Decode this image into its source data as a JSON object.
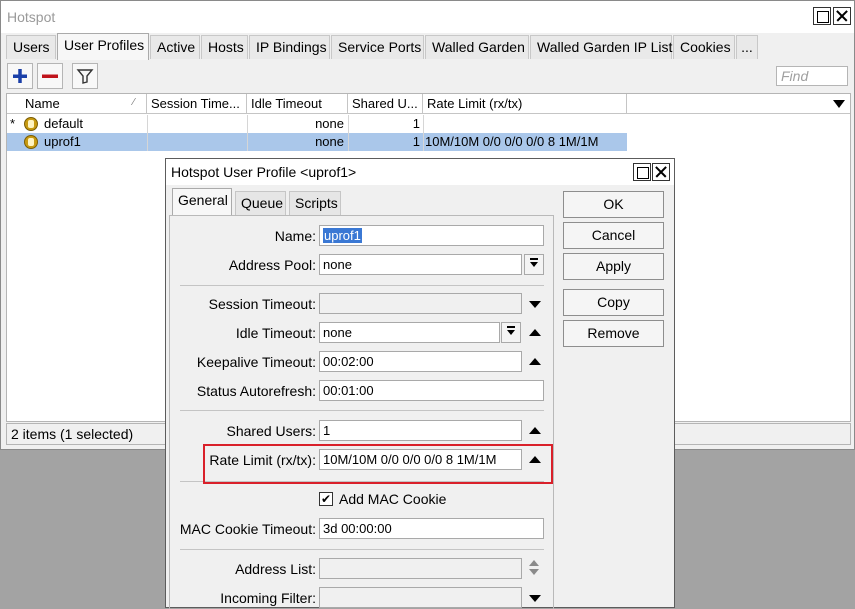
{
  "window": {
    "title": "Hotspot",
    "tabs": [
      "Users",
      "User Profiles",
      "Active",
      "Hosts",
      "IP Bindings",
      "Service Ports",
      "Walled Garden",
      "Walled Garden IP List",
      "Cookies",
      "..."
    ],
    "active_tab": "User Profiles"
  },
  "toolbar": {
    "find_placeholder": "Find"
  },
  "grid": {
    "columns": [
      "Name",
      "Session Time...",
      "Idle Timeout",
      "Shared U...",
      "Rate Limit (rx/tx)"
    ],
    "rows": [
      {
        "marker": "*",
        "name": "default",
        "session_timeout": "",
        "idle_timeout": "none",
        "shared_users": "1",
        "rate_limit": ""
      },
      {
        "marker": "",
        "name": "uprof1",
        "session_timeout": "",
        "idle_timeout": "none",
        "shared_users": "1",
        "rate_limit": "10M/10M 0/0 0/0 0/0 8 1M/1M"
      }
    ]
  },
  "status": "2 items (1 selected)",
  "dialog": {
    "title": "Hotspot User Profile <uprof1>",
    "tabs": [
      "General",
      "Queue",
      "Scripts"
    ],
    "active_tab": "General",
    "buttons": [
      "OK",
      "Cancel",
      "Apply",
      "Copy",
      "Remove"
    ],
    "fields": {
      "name_label": "Name:",
      "name_value": "uprof1",
      "address_pool_label": "Address Pool:",
      "address_pool_value": "none",
      "session_timeout_label": "Session Timeout:",
      "session_timeout_value": "",
      "idle_timeout_label": "Idle Timeout:",
      "idle_timeout_value": "none",
      "keepalive_timeout_label": "Keepalive Timeout:",
      "keepalive_timeout_value": "00:02:00",
      "status_autorefresh_label": "Status Autorefresh:",
      "status_autorefresh_value": "00:01:00",
      "shared_users_label": "Shared Users:",
      "shared_users_value": "1",
      "rate_limit_label": "Rate Limit (rx/tx):",
      "rate_limit_value": "10M/10M 0/0 0/0 0/0 8 1M/1M",
      "add_mac_cookie_label": "Add MAC Cookie",
      "add_mac_cookie_checked": true,
      "mac_cookie_timeout_label": "MAC Cookie Timeout:",
      "mac_cookie_timeout_value": "3d 00:00:00",
      "address_list_label": "Address List:",
      "address_list_value": "",
      "incoming_filter_label": "Incoming Filter:",
      "incoming_filter_value": ""
    }
  },
  "colors": {
    "selection_row": "#aac7ea",
    "highlight_box": "#d9202a",
    "add_icon": "#1a3fa8",
    "remove_icon": "#c0141c"
  }
}
